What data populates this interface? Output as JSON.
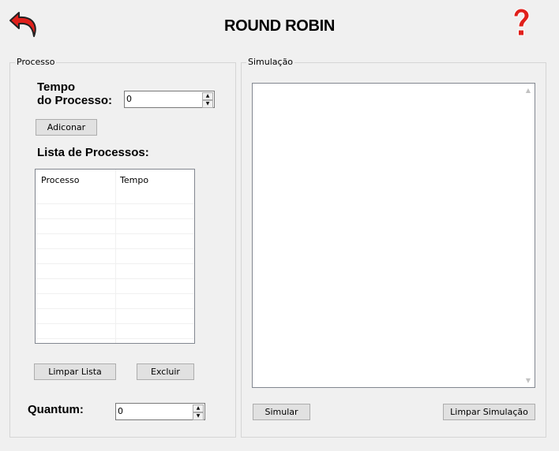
{
  "window": {
    "title": "ROUND ROBIN"
  },
  "icons": {
    "back": "back-arrow-icon",
    "help": "help-question-icon",
    "accent": "#e0201b"
  },
  "processo": {
    "legend": "Processo",
    "tempo_label_line1": "Tempo",
    "tempo_label_line2": "do Processo:",
    "tempo_value": "0",
    "add_button": "Adiconar",
    "list_title": "Lista de Processos:",
    "columns": [
      "Processo",
      "Tempo"
    ],
    "rows": [],
    "clear_list_button": "Limpar Lista",
    "delete_button": "Excluir",
    "quantum_label": "Quantum:",
    "quantum_value": "0"
  },
  "simulacao": {
    "legend": "Simulação",
    "output_text": "",
    "simulate_button": "Simular",
    "clear_simulation_button": "Limpar Simulação"
  }
}
